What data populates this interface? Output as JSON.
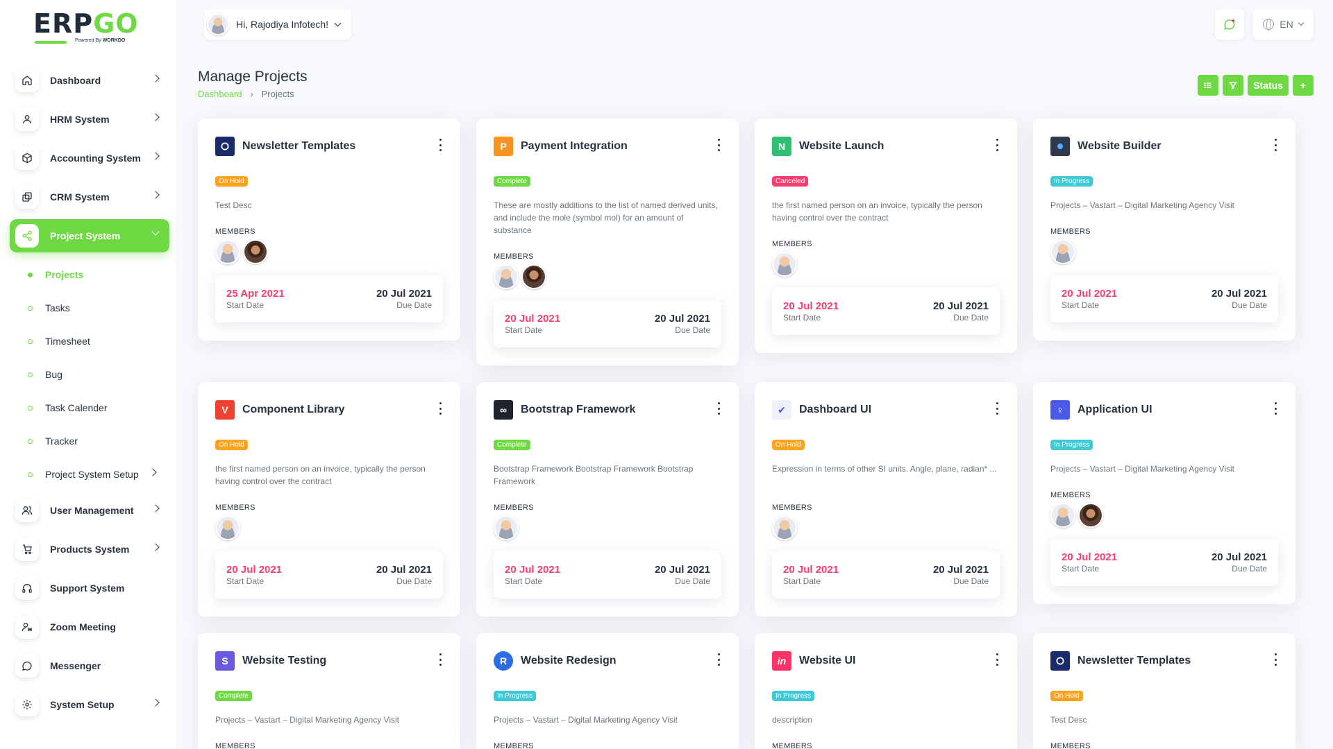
{
  "logo": {
    "erp": "ERP",
    "go": "GO",
    "sub_prefix": "Powered By ",
    "sub_brand": "WORKDO"
  },
  "header": {
    "greeting": "Hi, Rajodiya Infotech!",
    "language": "EN"
  },
  "colors": {
    "accent": "#6fd943",
    "on_hold": "#ffa21d",
    "complete": "#6fd943",
    "canceled": "#ff3a6e",
    "in_progress": "#3ec9d6",
    "start_date": "#ff3a6e"
  },
  "sidebar": {
    "items": [
      {
        "label": "Dashboard",
        "icon": "home-icon"
      },
      {
        "label": "HRM System",
        "icon": "user-icon"
      },
      {
        "label": "Accounting System",
        "icon": "box-icon"
      },
      {
        "label": "CRM System",
        "icon": "layers-icon"
      },
      {
        "label": "Project System",
        "icon": "share-icon"
      }
    ],
    "project_sub": [
      "Projects",
      "Tasks",
      "Timesheet",
      "Bug",
      "Task Calender",
      "Tracker",
      "Project System Setup"
    ],
    "items_after": [
      {
        "label": "User Management",
        "icon": "users-icon"
      },
      {
        "label": "Products System",
        "icon": "cart-icon"
      },
      {
        "label": "Support System",
        "icon": "headphones-icon"
      },
      {
        "label": "Zoom Meeting",
        "icon": "user-video-icon"
      },
      {
        "label": "Messenger",
        "icon": "message-icon"
      },
      {
        "label": "System Setup",
        "icon": "settings-icon"
      }
    ]
  },
  "page": {
    "title": "Manage Projects",
    "breadcrumb": [
      "Dashboard",
      "Projects"
    ]
  },
  "actions": {
    "status_label": "Status",
    "add_label": "+"
  },
  "labels": {
    "members": "MEMBERS",
    "start_date": "Start Date",
    "due_date": "Due Date"
  },
  "projects": [
    {
      "name": "Newsletter Templates",
      "status": "On Hold",
      "desc": "Test Desc",
      "start": "25 Apr 2021",
      "due": "20 Jul 2021"
    },
    {
      "name": "Payment Integration",
      "status": "Complete",
      "desc": "These are mostly additions to the list of named derived units, and include the mole (symbol mol) for an amount of substance",
      "start": "20 Jul 2021",
      "due": "20 Jul 2021"
    },
    {
      "name": "Website Launch",
      "status": "Canceled",
      "desc": "the first named person on an invoice, typically the person having control over the contract",
      "start": "20 Jul 2021",
      "due": "20 Jul 2021"
    },
    {
      "name": "Website Builder",
      "status": "In Progress",
      "desc": "Projects – Vastart – Digital Marketing Agency Visit",
      "start": "20 Jul 2021",
      "due": "20 Jul 2021"
    },
    {
      "name": "Component Library",
      "status": "On Hold",
      "desc": "the first named person on an invoice, typically the person having control over the contract",
      "start": "20 Jul 2021",
      "due": "20 Jul 2021"
    },
    {
      "name": "Bootstrap Framework",
      "status": "Complete",
      "desc": "Bootstrap Framework Bootstrap Framework Bootstrap Framework",
      "start": "20 Jul 2021",
      "due": "20 Jul 2021"
    },
    {
      "name": "Dashboard UI",
      "status": "On Hold",
      "desc": "Expression in terms of other SI units. Angle, plane, radian* ...",
      "start": "20 Jul 2021",
      "due": "20 Jul 2021"
    },
    {
      "name": "Application UI",
      "status": "In Progress",
      "desc": "Projects – Vastart – Digital Marketing Agency Visit",
      "start": "20 Jul 2021",
      "due": "20 Jul 2021"
    },
    {
      "name": "Website Testing",
      "status": "Complete",
      "desc": "Projects – Vastart – Digital Marketing Agency Visit"
    },
    {
      "name": "Website Redesign",
      "status": "In Progress",
      "desc": "Projects – Vastart – Digital Marketing Agency Visit"
    },
    {
      "name": "Website UI",
      "status": "In Progress",
      "desc": "description"
    },
    {
      "name": "Newsletter Templates",
      "status": "On Hold",
      "desc": "Test Desc"
    }
  ]
}
